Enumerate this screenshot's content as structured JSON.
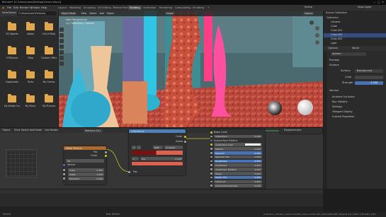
{
  "window": {
    "title": "Blender* [C:\\Users\\user\\Desktop\\Scene.blend]"
  },
  "menubar": {
    "items": [
      "File",
      "Edit",
      "Render",
      "Window",
      "Help"
    ],
    "workspaces": [
      "Layout",
      "Modeling",
      "Sculpting",
      "UV Editing",
      "Texture Paint",
      "Shading",
      "Animation",
      "Rendering",
      "Compositing",
      "Scripting"
    ],
    "active_workspace": "Shading",
    "scene_label": "Scene",
    "view_layer_label": "View Layer"
  },
  "file_browser": {
    "header": [
      "View",
      "Select",
      "Bookmarks"
    ],
    "path": "C:\\Users\\user\\Pictures\\",
    "folders": [
      "3D Objects",
      "Adobe",
      "Call of Duty",
      "CGTexture",
      "CRap",
      "Custom Office",
      "Downloads",
      "Fonts",
      "My Games",
      "My Kindle Content",
      "My Music",
      "My Pictures"
    ]
  },
  "viewport": {
    "toolbar": [
      "Object Mode",
      "View",
      "Select",
      "Add",
      "Object"
    ],
    "overlay_text": [
      "User Perspective",
      "(1) Collection | Sphere"
    ],
    "transform_label": "Global",
    "options_label": "Options"
  },
  "outliner": {
    "title": "Scene Collection",
    "items": [
      "Collection",
      "Camera",
      "Cube",
      "Cube.001",
      "Cube.002",
      "Cube.003",
      "Light"
    ],
    "tabs": [
      "Options",
      "World"
    ]
  },
  "properties": {
    "object_name": "Sphere",
    "sections": [
      "Preview",
      "Surface"
    ],
    "surface_label": "Surface",
    "surface_value": "Background",
    "color_label": "Color",
    "strength_label": "Strength",
    "strength_value": "1.000",
    "volume_label": "Volume",
    "panel_items": [
      "Ambient Occlusion",
      "Ray Visibility",
      "Settings",
      "Viewport Display",
      "Custom Properties"
    ]
  },
  "node_editor": {
    "header": [
      "Object",
      "View",
      "Select",
      "Add",
      "Node",
      "Use Nodes"
    ],
    "material_label": "Material.001",
    "nodes": {
      "color_ramp": {
        "title": "ColorRamp",
        "outputs": [
          "Color",
          "Alpha"
        ],
        "mode": "RGB",
        "interp": "Constant",
        "pos_label": "Pos",
        "pos_value": "0.478",
        "input": "Fac"
      },
      "noise": {
        "title": "Noise Texture",
        "outputs": [
          "Fac",
          "Color"
        ],
        "dim": "3D",
        "vector": "Vector",
        "fields": [
          {
            "label": "Scale",
            "value": "2.300"
          },
          {
            "label": "Detail",
            "value": "2.000"
          },
          {
            "label": "Distortion",
            "value": "0.000"
          }
        ]
      },
      "bsdf": {
        "title": "Principled BSDF",
        "output": "BSDF",
        "rows": [
          {
            "label": "Base Color",
            "value": ""
          },
          {
            "label": "Subsurface",
            "value": "0.000"
          },
          {
            "label": "Subsurface Radius",
            "value": ""
          },
          {
            "label": "Subsurface Color",
            "value": ""
          },
          {
            "label": "Metallic",
            "value": "0.000"
          },
          {
            "label": "Specular",
            "value": "0.500"
          },
          {
            "label": "Specular Tint",
            "value": "0.000"
          },
          {
            "label": "Roughness",
            "value": "0.500"
          },
          {
            "label": "Anisotropic",
            "value": "0.000"
          },
          {
            "label": "Anisotropic Rotation",
            "value": "0.000"
          },
          {
            "label": "Sheen",
            "value": "0.000"
          },
          {
            "label": "Sheen Tint",
            "value": "0.500"
          },
          {
            "label": "Clearcoat",
            "value": "0.000"
          },
          {
            "label": "Clearcoat Roughness",
            "value": "0.030"
          }
        ]
      },
      "output": {
        "title": "Material Output",
        "socket": "Displacement"
      }
    }
  },
  "statusbar": {
    "left": "Select",
    "middle": "Box Select",
    "right": "Collection | Sphere | Verts:719,844 | Faces:1,425,164 | Tris:2,850,328 | Objects:1/6 | Mem:1.58 GiB | 2.83"
  },
  "colors": {
    "accent": "#4772b3",
    "folder": "#e0a84a",
    "node_blue": "#4d7fb8"
  }
}
